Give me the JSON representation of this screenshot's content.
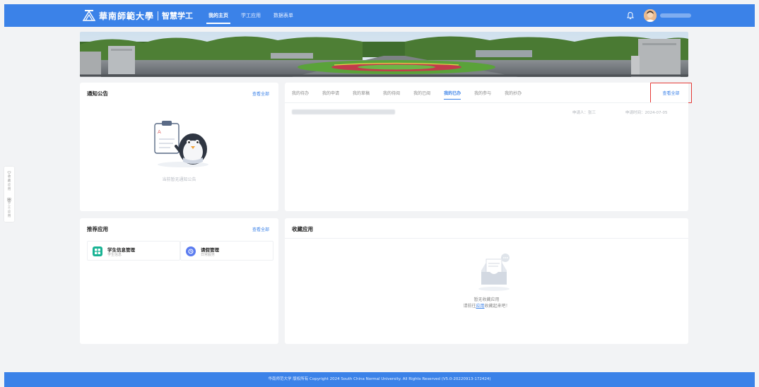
{
  "header": {
    "logo_text": "華南師範大學",
    "system_name": "智慧学工",
    "nav": [
      "我的主页",
      "学工应用",
      "数据表单"
    ],
    "active_nav": 0
  },
  "notice": {
    "title": "通知公告",
    "view_all": "查看全部",
    "empty_text": "当前暂无通知公告"
  },
  "tasks": {
    "tabs": [
      "我的待办",
      "我的申请",
      "我的草稿",
      "我的待阅",
      "我的已阅",
      "我的已办",
      "我的参与",
      "我的抄办"
    ],
    "active_tab": 5,
    "view_all": "查看全部",
    "row": {
      "applicant": "申请人：张三",
      "date": "申请时间：2024-07-05"
    }
  },
  "apps": {
    "title": "推荐应用",
    "view_all": "查看全部",
    "items": [
      {
        "name": "学生信息管理",
        "desc": "学生信息",
        "icon": "grid-icon",
        "color": "#19b394"
      },
      {
        "name": "请假管理",
        "desc": "日常服务",
        "icon": "leave-icon",
        "color": "#5b7cf0"
      }
    ]
  },
  "favorites": {
    "title": "收藏应用",
    "empty_line1": "暂无收藏应用",
    "empty_line2_pre": "请前往",
    "empty_line2_link": "应用",
    "empty_line2_post": "收藏起来吧！"
  },
  "side": {
    "collect_label": "收藏应用",
    "apps_label": "学工应用"
  },
  "footer": {
    "text": "华南师范大学 版权所有 Copyright 2024 South China Normal University. All Rights Reserved  (V5.0-20220913-172424)"
  },
  "colors": {
    "primary": "#3b82e8",
    "highlight_box": "#e53935"
  }
}
